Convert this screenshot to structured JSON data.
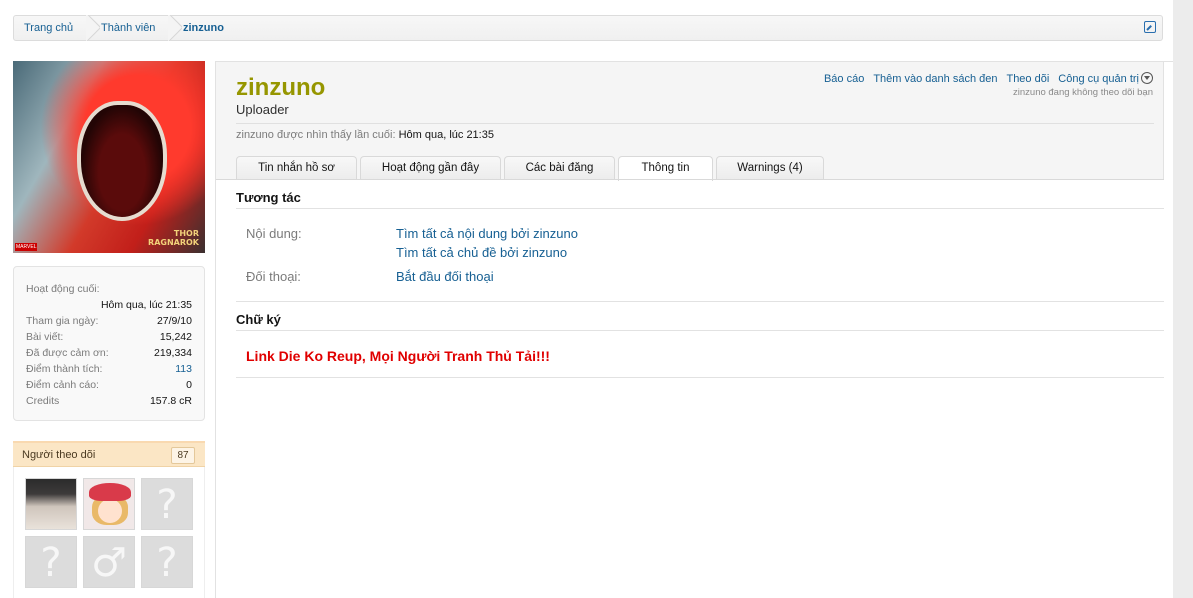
{
  "breadcrumb": {
    "items": [
      {
        "label": "Trang chủ"
      },
      {
        "label": "Thành viên"
      },
      {
        "label": "zinzuno"
      }
    ]
  },
  "avatar_caption": {
    "line1": "THOR",
    "line2": "RAGNAROK"
  },
  "stats": [
    {
      "label": "Hoạt động cuối:",
      "value": "Hôm qua, lúc 21:35"
    },
    {
      "label": "Tham gia ngày:",
      "value": "27/9/10"
    },
    {
      "label": "Bài viết:",
      "value": "15,242"
    },
    {
      "label": "Đã được cảm ơn:",
      "value": "219,334"
    },
    {
      "label": "Điểm thành tích:",
      "value": "113"
    },
    {
      "label": "Điểm cảnh cáo:",
      "value": "0"
    },
    {
      "label": "Credits",
      "value": "157.8 cR"
    }
  ],
  "followers": {
    "title": "Người theo dõi",
    "count": "87",
    "placeholder_glyphs": [
      "?",
      "?",
      "♂",
      "?"
    ]
  },
  "profile": {
    "username": "zinzuno",
    "user_title": "Uploader",
    "last_seen_label": "zinzuno được nhìn thấy lần cuối:",
    "last_seen_value": "Hôm qua, lúc 21:35"
  },
  "actions": {
    "report": "Báo cáo",
    "blacklist": "Thêm vào danh sách đen",
    "follow": "Theo dõi",
    "moderator_tools": "Công cụ quản trị",
    "follow_status": "zinzuno đang không theo dõi bạn"
  },
  "tabs": [
    {
      "label": "Tin nhắn hồ sơ"
    },
    {
      "label": "Hoạt động gần đây"
    },
    {
      "label": "Các bài đăng"
    },
    {
      "label": "Thông tin",
      "active": true
    },
    {
      "label": "Warnings (4)"
    }
  ],
  "interaction": {
    "title": "Tương tác",
    "content_label": "Nội dung:",
    "content_link1": "Tìm tất cả nội dung bởi zinzuno",
    "content_link2": "Tìm tất cả chủ đề bởi zinzuno",
    "conversation_label": "Đối thoại:",
    "conversation_link": "Bắt đầu đối thoại"
  },
  "signature": {
    "title": "Chữ ký",
    "text": "Link Die Ko Reup, Mọi Người Tranh Thủ Tải!!!"
  }
}
